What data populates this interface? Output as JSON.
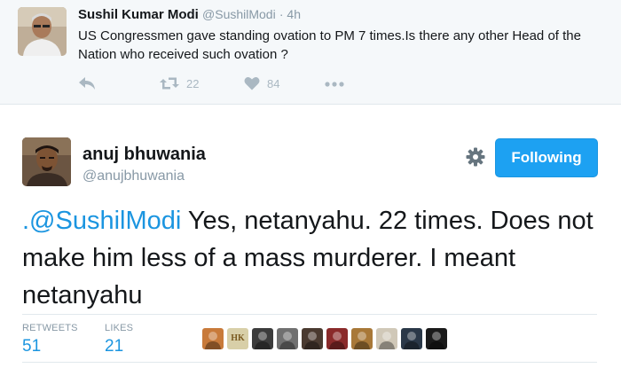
{
  "parent_tweet": {
    "name": "Sushil Kumar Modi",
    "handle": "@SushilModi",
    "time": "· 4h",
    "text": "US Congressmen gave standing ovation to PM 7 times.Is there any other Head of the Nation who received such ovation ?",
    "retweet_count": "22",
    "like_count": "84",
    "icons": [
      "reply-icon",
      "retweet-icon",
      "heart-icon",
      "more-icon"
    ]
  },
  "main_tweet": {
    "name": "anuj bhuwania",
    "handle": "@anujbhuwania",
    "follow_label": "Following",
    "mention": ".@SushilModi",
    "text": " Yes, netanyahu. 22 times. Does not make him less of a mass murderer. I meant netanyahu",
    "stats": {
      "retweets_label": "RETWEETS",
      "retweets_value": "51",
      "likes_label": "LIKES",
      "likes_value": "21"
    },
    "liker_avatar_logo_text": "HK",
    "liker_avatar_colors": [
      "#c87a3a",
      "#d8cfa8",
      "#3c3c3c",
      "#707070",
      "#4a3a30",
      "#8a2a2a",
      "#a87838",
      "#d0c8b8",
      "#2a3848",
      "#1a1a1a"
    ]
  },
  "colors": {
    "accent": "#1da1f2",
    "link": "#1b95e0",
    "muted": "#8899a6",
    "parent_bg": "#f5f8fa"
  }
}
